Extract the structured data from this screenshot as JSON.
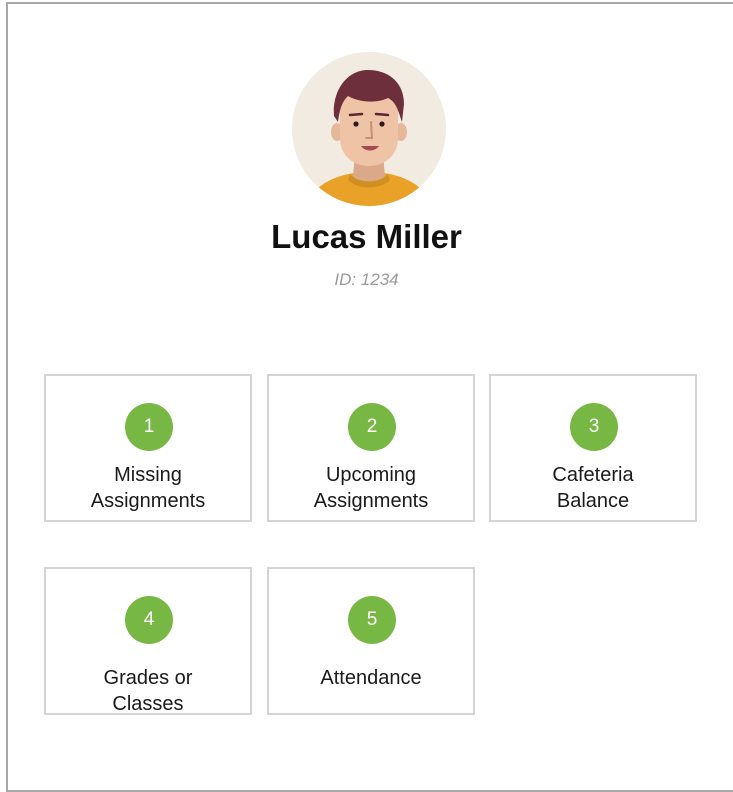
{
  "student": {
    "name": "Lucas Miller",
    "id_text": "ID: 1234"
  },
  "colors": {
    "accent": "#77b844",
    "tile_border": "#d4d4d4",
    "muted_text": "#9a9a9a"
  },
  "tiles": [
    {
      "number": "1",
      "line1": "Missing",
      "line2": "Assignments"
    },
    {
      "number": "2",
      "line1": "Upcoming",
      "line2": "Assignments"
    },
    {
      "number": "3",
      "line1": "Cafeteria",
      "line2": "Balance"
    },
    {
      "number": "4",
      "line1": "Grades or",
      "line2": "Classes"
    },
    {
      "number": "5",
      "line1": "Attendance",
      "line2": ""
    }
  ]
}
